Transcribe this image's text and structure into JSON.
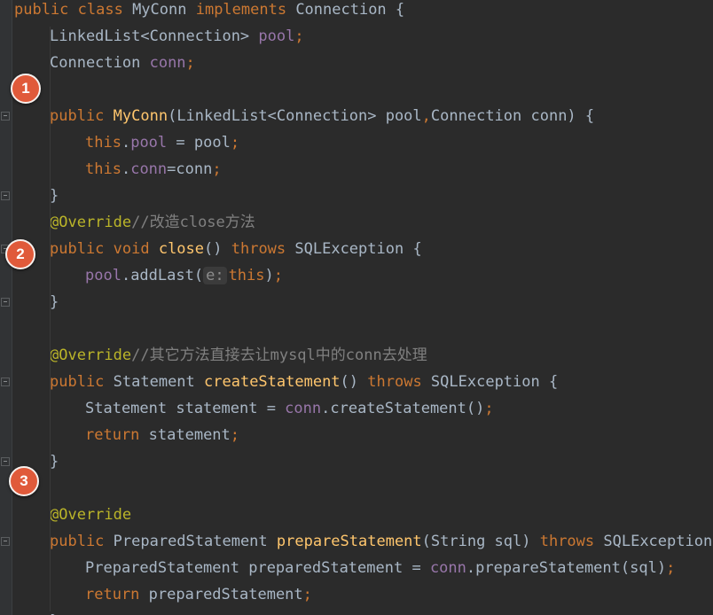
{
  "editor": {
    "theme_colors": {
      "background": "#2b2b2b",
      "keyword": "#cc7832",
      "method": "#ffc66d",
      "field": "#9876aa",
      "annotation": "#bbb529",
      "comment": "#808080",
      "text": "#a9b7c6",
      "marker": "#e05a3a"
    },
    "markers": [
      "1",
      "2",
      "3"
    ],
    "param_hint": "e:",
    "lines": [
      [
        [
          "kw",
          "public class "
        ],
        [
          "txt",
          "MyConn "
        ],
        [
          "kw",
          "implements "
        ],
        [
          "txt",
          "Connection {"
        ]
      ],
      [
        [
          "txt",
          "LinkedList<Connection> "
        ],
        [
          "field",
          "pool"
        ],
        [
          "kw",
          ";"
        ]
      ],
      [
        [
          "txt",
          "Connection "
        ],
        [
          "field",
          "conn"
        ],
        [
          "kw",
          ";"
        ]
      ],
      [],
      [
        [
          "kw",
          "public "
        ],
        [
          "fn",
          "MyConn"
        ],
        [
          "txt",
          "(LinkedList<Connection> pool"
        ],
        [
          "kw",
          ","
        ],
        [
          "txt",
          "Connection conn) {"
        ]
      ],
      [
        [
          "kw",
          "this"
        ],
        [
          "txt",
          "."
        ],
        [
          "field",
          "pool"
        ],
        [
          "txt",
          " = pool"
        ],
        [
          "kw",
          ";"
        ]
      ],
      [
        [
          "kw",
          "this"
        ],
        [
          "txt",
          "."
        ],
        [
          "field",
          "conn"
        ],
        [
          "txt",
          "=conn"
        ],
        [
          "kw",
          ";"
        ]
      ],
      [
        [
          "txt",
          "}"
        ]
      ],
      [
        [
          "ann",
          "@Override"
        ],
        [
          "cmt",
          "//改造close方法"
        ]
      ],
      [
        [
          "kw",
          "public void "
        ],
        [
          "fn",
          "close"
        ],
        [
          "txt",
          "() "
        ],
        [
          "kw",
          "throws "
        ],
        [
          "txt",
          "SQLException {"
        ]
      ],
      [
        [
          "field",
          "pool"
        ],
        [
          "txt",
          ".addLast("
        ],
        [
          "hint",
          "e:"
        ],
        [
          "kw",
          "this"
        ],
        [
          "txt",
          ")"
        ],
        [
          "kw",
          ";"
        ]
      ],
      [
        [
          "txt",
          "}"
        ]
      ],
      [],
      [
        [
          "ann",
          "@Override"
        ],
        [
          "cmt",
          "//其它方法直接去让mysql中的conn去处理"
        ]
      ],
      [
        [
          "kw",
          "public "
        ],
        [
          "txt",
          "Statement "
        ],
        [
          "fn",
          "createStatement"
        ],
        [
          "txt",
          "() "
        ],
        [
          "kw",
          "throws "
        ],
        [
          "txt",
          "SQLException {"
        ]
      ],
      [
        [
          "txt",
          "Statement statement = "
        ],
        [
          "field",
          "conn"
        ],
        [
          "txt",
          ".createStatement()"
        ],
        [
          "kw",
          ";"
        ]
      ],
      [
        [
          "kw",
          "return "
        ],
        [
          "txt",
          "statement"
        ],
        [
          "kw",
          ";"
        ]
      ],
      [
        [
          "txt",
          "}"
        ]
      ],
      [],
      [
        [
          "ann",
          "@Override"
        ]
      ],
      [
        [
          "kw",
          "public "
        ],
        [
          "txt",
          "PreparedStatement "
        ],
        [
          "fn",
          "prepareStatement"
        ],
        [
          "txt",
          "(String sql) "
        ],
        [
          "kw",
          "throws "
        ],
        [
          "txt",
          "SQLException {"
        ]
      ],
      [
        [
          "txt",
          "PreparedStatement preparedStatement = "
        ],
        [
          "field",
          "conn"
        ],
        [
          "txt",
          ".prepareStatement(sql)"
        ],
        [
          "kw",
          ";"
        ]
      ],
      [
        [
          "kw",
          "return "
        ],
        [
          "txt",
          "preparedStatement"
        ],
        [
          "kw",
          ";"
        ]
      ],
      [
        [
          "txt",
          "}"
        ]
      ]
    ]
  }
}
